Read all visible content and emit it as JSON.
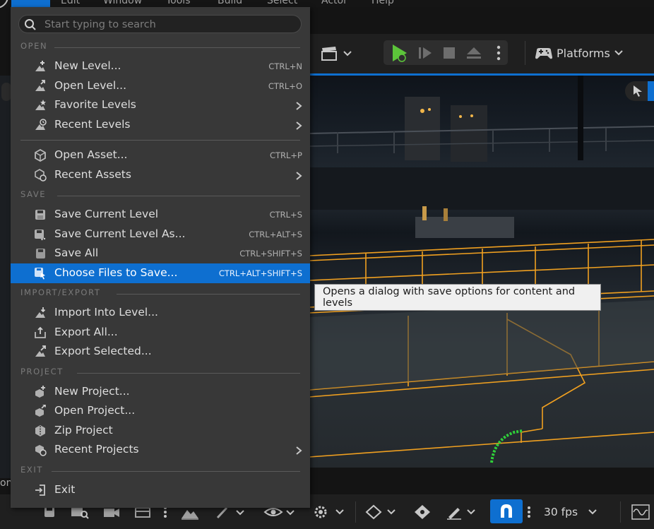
{
  "menubar": {
    "items": [
      "File",
      "Edit",
      "Window",
      "Tools",
      "Build",
      "Select",
      "Actor",
      "Help"
    ]
  },
  "toolbar": {
    "platforms_label": "Platforms"
  },
  "bottom_toolbar": {
    "fps_label": "30 fps"
  },
  "left_panel": {
    "partial_label": "on"
  },
  "tooltip": {
    "text": "Opens a dialog with save options for content and levels"
  },
  "file_menu": {
    "search_placeholder": "Start typing to search",
    "sections": {
      "open": "OPEN",
      "save": "SAVE",
      "import_export": "IMPORT/EXPORT",
      "project": "PROJECT",
      "exit": "EXIT"
    },
    "items": {
      "new_level": {
        "label": "New Level...",
        "shortcut": "CTRL+N",
        "icon": "new-level-icon"
      },
      "open_level": {
        "label": "Open Level...",
        "shortcut": "CTRL+O",
        "icon": "open-level-icon"
      },
      "favorite_levels": {
        "label": "Favorite Levels",
        "icon": "favorite-levels-icon"
      },
      "recent_levels": {
        "label": "Recent Levels",
        "icon": "recent-levels-icon"
      },
      "open_asset": {
        "label": "Open Asset...",
        "shortcut": "CTRL+P",
        "icon": "open-asset-icon"
      },
      "recent_assets": {
        "label": "Recent Assets",
        "icon": "recent-assets-icon"
      },
      "save_current_level": {
        "label": "Save Current Level",
        "shortcut": "CTRL+S",
        "icon": "save-icon"
      },
      "save_current_level_as": {
        "label": "Save Current Level As...",
        "shortcut": "CTRL+ALT+S",
        "icon": "save-as-icon"
      },
      "save_all": {
        "label": "Save All",
        "shortcut": "CTRL+SHIFT+S",
        "icon": "save-all-icon"
      },
      "choose_files": {
        "label": "Choose Files to Save...",
        "shortcut": "CTRL+ALT+SHIFT+S",
        "icon": "choose-files-icon"
      },
      "import_into_level": {
        "label": "Import Into Level...",
        "icon": "import-icon"
      },
      "export_all": {
        "label": "Export All...",
        "icon": "export-all-icon"
      },
      "export_selected": {
        "label": "Export Selected...",
        "icon": "export-selected-icon"
      },
      "new_project": {
        "label": "New Project...",
        "icon": "new-project-icon"
      },
      "open_project": {
        "label": "Open Project...",
        "icon": "open-project-icon"
      },
      "zip_project": {
        "label": "Zip Project",
        "icon": "zip-project-icon"
      },
      "recent_projects": {
        "label": "Recent Projects",
        "icon": "recent-projects-icon"
      },
      "exit": {
        "label": "Exit",
        "icon": "exit-icon"
      }
    }
  },
  "colors": {
    "accent": "#0e6fd0",
    "menu_bg": "#383838",
    "wireframe": "#f0a020",
    "play_green": "#5cc43a"
  }
}
